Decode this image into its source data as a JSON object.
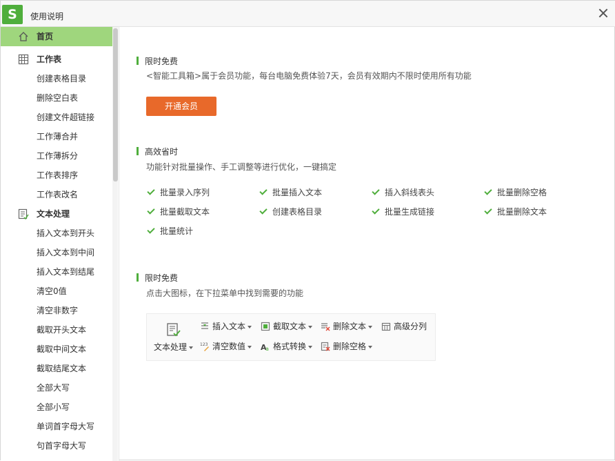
{
  "window": {
    "title": "使用说明",
    "logo": "S"
  },
  "sidebar": {
    "items": [
      {
        "label": "首页",
        "icon": "home-icon",
        "type": "group",
        "active": true
      },
      {
        "label": "工作表",
        "icon": "sheet-icon",
        "type": "group"
      },
      {
        "label": "创建表格目录",
        "type": "item"
      },
      {
        "label": "删除空白表",
        "type": "item"
      },
      {
        "label": "创建文件超链接",
        "type": "item"
      },
      {
        "label": "工作薄合并",
        "type": "item"
      },
      {
        "label": "工作薄拆分",
        "type": "item"
      },
      {
        "label": "工作表排序",
        "type": "item"
      },
      {
        "label": "工作表改名",
        "type": "item"
      },
      {
        "label": "文本处理",
        "icon": "text-edit-icon",
        "type": "group"
      },
      {
        "label": "插入文本到开头",
        "type": "item"
      },
      {
        "label": "插入文本到中间",
        "type": "item"
      },
      {
        "label": "插入文本到结尾",
        "type": "item"
      },
      {
        "label": "清空0值",
        "type": "item"
      },
      {
        "label": "清空非数字",
        "type": "item"
      },
      {
        "label": "截取开头文本",
        "type": "item"
      },
      {
        "label": "截取中间文本",
        "type": "item"
      },
      {
        "label": "截取结尾文本",
        "type": "item"
      },
      {
        "label": "全部大写",
        "type": "item"
      },
      {
        "label": "全部小写",
        "type": "item"
      },
      {
        "label": "单词首字母大写",
        "type": "item"
      },
      {
        "label": "句首字母大写",
        "type": "item"
      }
    ]
  },
  "main": {
    "section1": {
      "title": "限时免费",
      "desc": "<智能工具箱>属于会员功能，每台电脑免费体验7天，会员有效期内不限时使用所有功能",
      "button": "开通会员"
    },
    "section2": {
      "title": "高效省时",
      "desc": "功能针对批量操作、手工调整等进行优化，一键搞定",
      "features": [
        "批量录入序列",
        "批量插入文本",
        "插入斜线表头",
        "批量删除空格",
        "批量截取文本",
        "创建表格目录",
        "批量生成链接",
        "批量删除文本",
        "批量统计"
      ]
    },
    "section3": {
      "title": "限时免费",
      "desc": "点击大图标，在下拉菜单中找到需要的功能",
      "toolbar": {
        "big": {
          "label": "文本处理",
          "icon": "text-process-icon"
        },
        "buttons": [
          {
            "label": "插入文本",
            "icon": "insert-text-icon",
            "caret": true
          },
          {
            "label": "截取文本",
            "icon": "extract-text-icon",
            "caret": true
          },
          {
            "label": "删除文本",
            "icon": "delete-text-icon",
            "caret": true
          },
          {
            "label": "高级分列",
            "icon": "split-columns-icon",
            "caret": false
          },
          {
            "label": "清空数值",
            "icon": "clear-values-icon",
            "caret": true
          },
          {
            "label": "格式转换",
            "icon": "format-convert-icon",
            "caret": true
          },
          {
            "label": "删除空格",
            "icon": "delete-space-icon",
            "caret": true
          }
        ]
      }
    }
  },
  "colors": {
    "accent": "#4fae3c",
    "active_bg": "#9fd67d",
    "button": "#e8692a"
  }
}
